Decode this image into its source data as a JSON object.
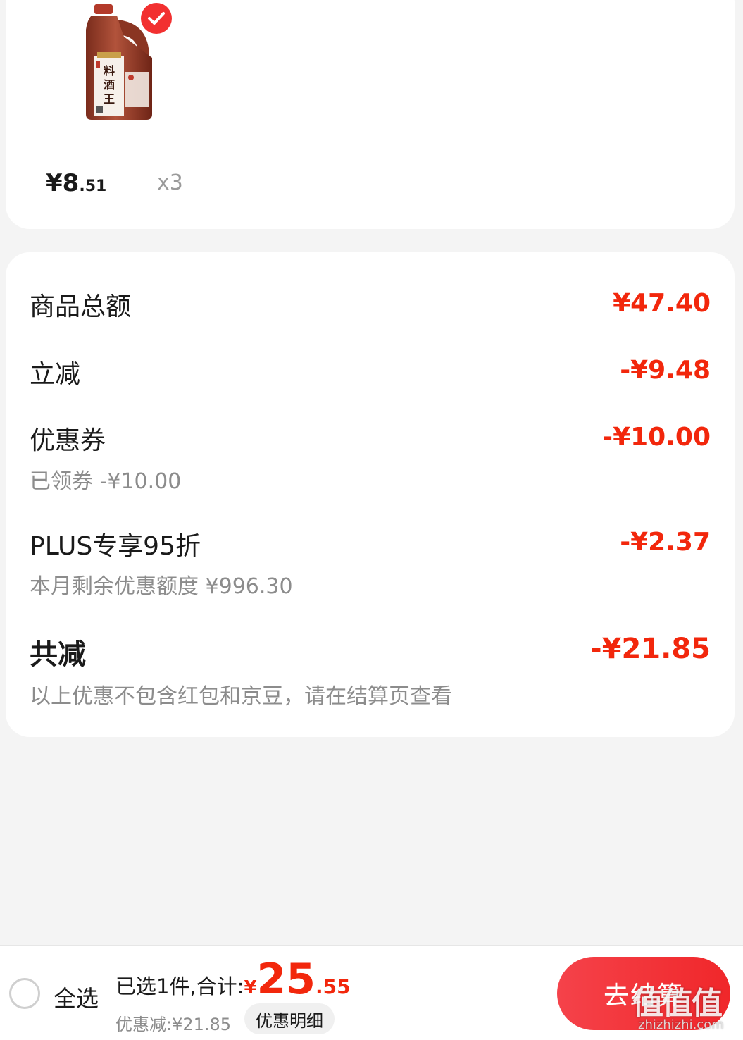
{
  "product": {
    "price_symbol": "¥",
    "price_int": "8",
    "price_dec": ".51",
    "quantity": "x3",
    "bottle_label": "料酒王",
    "selected": true
  },
  "summary": {
    "goods_total_label": "商品总额",
    "goods_total_value": "¥47.40",
    "instant_discount_label": "立减",
    "instant_discount_value": "-¥9.48",
    "coupon_label": "优惠券",
    "coupon_value": "-¥10.00",
    "coupon_sub": "已领券 -¥10.00",
    "plus_label": "PLUS专享95折",
    "plus_value": "-¥2.37",
    "plus_sub": "本月剩余优惠额度 ¥996.30",
    "total_label": "共减",
    "total_value": "-¥21.85",
    "note": "以上优惠不包含红包和京豆，请在结算页查看"
  },
  "bottom_bar": {
    "select_all_label": "全选",
    "selected_text": "已选1件,合计:",
    "total_currency": "¥",
    "total_int": "25",
    "total_dec": ".55",
    "discount_text": "优惠减:¥21.85",
    "detail_label": "优惠明细",
    "checkout_label": "去结算"
  },
  "watermark": {
    "logo": "值值值",
    "url": "zhizhizhi.com"
  },
  "colors": {
    "accent_red": "#f2270c",
    "button_red": "#f0272a",
    "background": "#f4f4f4"
  }
}
